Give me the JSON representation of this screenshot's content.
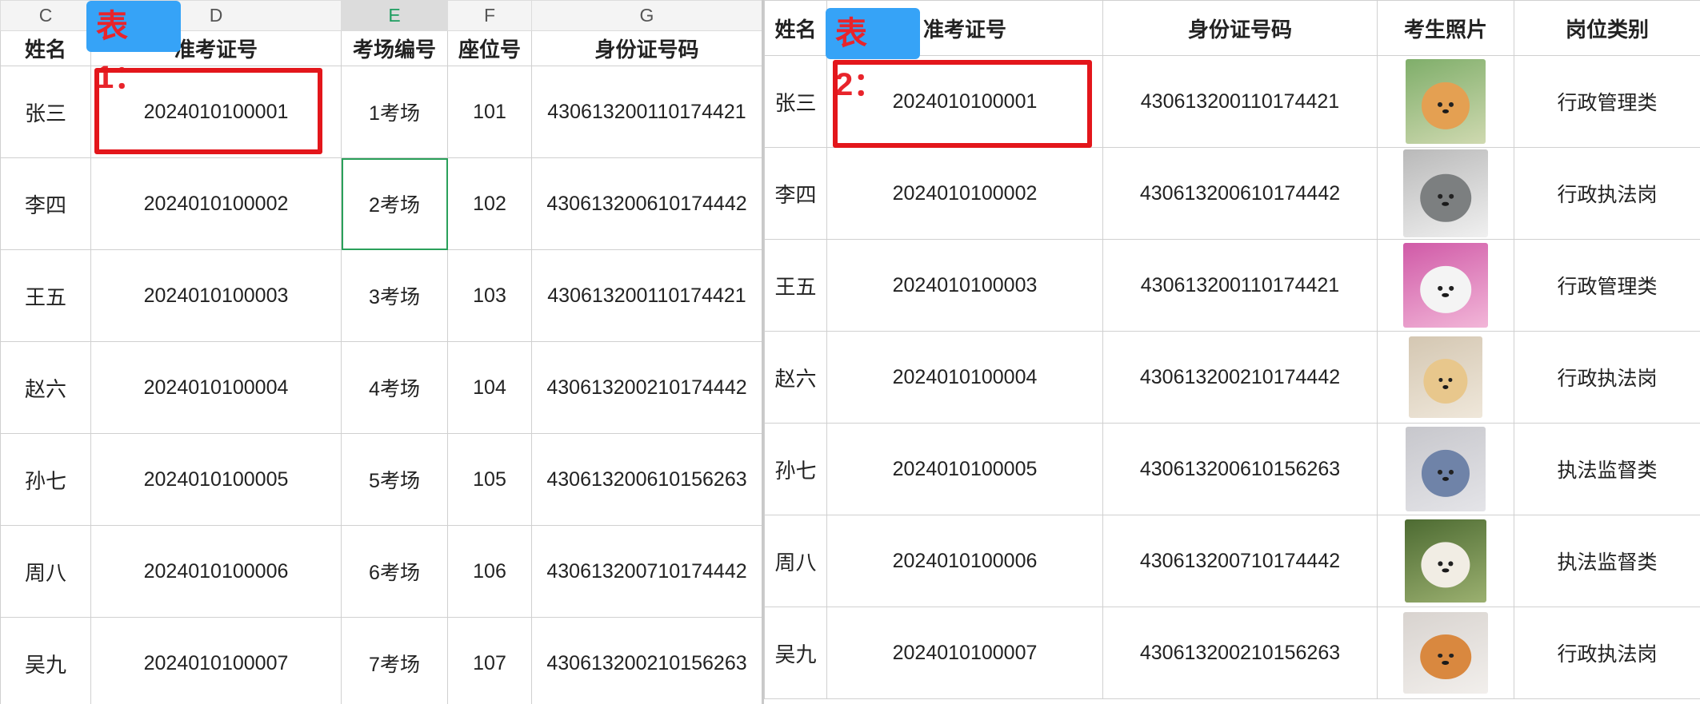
{
  "table1": {
    "badge": "表1：",
    "col_letters": [
      "C",
      "D",
      "E",
      "F",
      "G"
    ],
    "headers": [
      "姓名",
      "准考证号",
      "考场编号",
      "座位号",
      "身份证号码"
    ],
    "rows": [
      [
        "张三",
        "2024010100001",
        "1考场",
        "101",
        "430613200110174421"
      ],
      [
        "李四",
        "2024010100002",
        "2考场",
        "102",
        "430613200610174442"
      ],
      [
        "王五",
        "2024010100003",
        "3考场",
        "103",
        "430613200110174421"
      ],
      [
        "赵六",
        "2024010100004",
        "4考场",
        "104",
        "430613200210174442"
      ],
      [
        "孙七",
        "2024010100005",
        "5考场",
        "105",
        "430613200610156263"
      ],
      [
        "周八",
        "2024010100006",
        "6考场",
        "106",
        "430613200710174442"
      ],
      [
        "吴九",
        "2024010100007",
        "7考场",
        "107",
        "430613200210156263"
      ]
    ]
  },
  "table2": {
    "badge": "表2：",
    "headers": [
      "姓名",
      "准考证号",
      "身份证号码",
      "考生照片",
      "岗位类别"
    ],
    "rows": [
      [
        "张三",
        "2024010100001",
        "430613200110174421",
        "shiba-dog-photo",
        "行政管理类"
      ],
      [
        "李四",
        "2024010100002",
        "430613200610174442",
        "grey-cat-photo",
        "行政执法岗"
      ],
      [
        "王五",
        "2024010100003",
        "430613200110174421",
        "husky-dog-photo",
        "行政管理类"
      ],
      [
        "赵六",
        "2024010100004",
        "430613200210174442",
        "labrador-dog-photo",
        "行政执法岗"
      ],
      [
        "孙七",
        "2024010100005",
        "430613200610156263",
        "blue-dog-photo",
        "执法监督类"
      ],
      [
        "周八",
        "2024010100006",
        "430613200710174442",
        "border-collie-photo",
        "执法监督类"
      ],
      [
        "吴九",
        "2024010100007",
        "430613200210156263",
        "corgi-dog-photo",
        "行政执法岗"
      ]
    ]
  },
  "colors": {
    "accent_green": "#1e9e60",
    "badge_blue": "#36a3f7",
    "highlight_red": "#e3161b"
  }
}
